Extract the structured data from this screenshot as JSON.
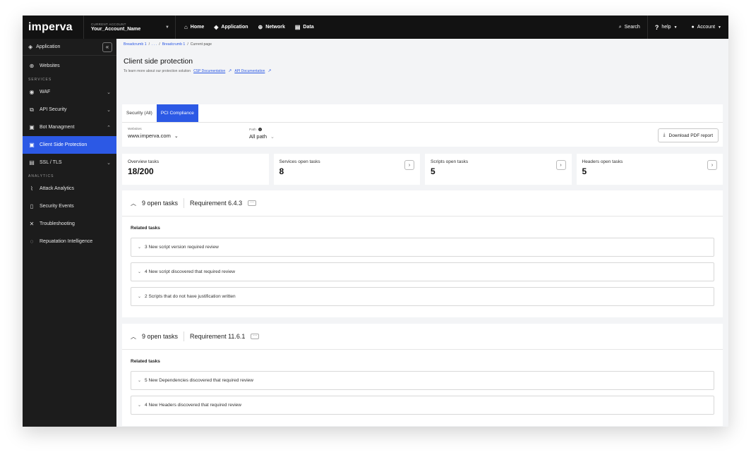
{
  "topbar": {
    "logo": "imperva",
    "account_label": "CURRENT ACCOUNT",
    "account_name": "Your_Account_Name",
    "nav": [
      {
        "label": "Home",
        "icon": "home-icon"
      },
      {
        "label": "Application",
        "icon": "application-icon"
      },
      {
        "label": "Network",
        "icon": "network-icon"
      },
      {
        "label": "Data",
        "icon": "data-icon"
      }
    ],
    "search_label": "Search",
    "help_label": "help",
    "account_menu_label": "Account"
  },
  "sidebar": {
    "header": "Application",
    "websites": "Websites",
    "services_section": "SERVICES",
    "services": [
      {
        "label": "WAF",
        "chevron": "down"
      },
      {
        "label": "API Security",
        "chevron": "down"
      },
      {
        "label": "Bot Managment",
        "chevron": "up"
      },
      {
        "label": "Client Side Protection",
        "active": true
      },
      {
        "label": "SSL / TLS",
        "chevron": "down"
      }
    ],
    "analytics_section": "ANALYTICS",
    "analytics": [
      {
        "label": "Attack Analytics"
      },
      {
        "label": "Security Events"
      },
      {
        "label": "Troubleshooting"
      },
      {
        "label": "Repuatation Intelligence"
      }
    ]
  },
  "breadcrumb": {
    "item1": "Breadcrumb 1",
    "sep1": "/",
    "ellipsis": ". . .",
    "sep2": "/",
    "item2": "Breadcrumb 1",
    "sep3": "/",
    "current": "Current page"
  },
  "page": {
    "title": "Client side protection",
    "subtitle": "To learn more about our protection solution",
    "csp_doc": "CSP Documentation",
    "api_doc": "API Documentation"
  },
  "tabs": [
    {
      "label": "Security (All)"
    },
    {
      "label": "PCI Compliance",
      "active": true
    }
  ],
  "filters": {
    "websites_label": "Websites",
    "websites_value": "www.imperva.com",
    "path_label": "Path",
    "path_value": "All path",
    "download_label": "Download PDF report"
  },
  "cards": [
    {
      "label": "Overview tasks",
      "value": "18/200"
    },
    {
      "label": "Services open tasks",
      "value": "8"
    },
    {
      "label": "Scripts open tasks",
      "value": "5"
    },
    {
      "label": "Headers open tasks",
      "value": "5"
    }
  ],
  "requirements": [
    {
      "open_tasks": "9 open tasks",
      "requirement": "Requirement 6.4.3",
      "related_label": "Related tasks",
      "tasks": [
        "3 New script version required review",
        "4 New script discovered that required review",
        "2 Scripts that do not have justification written"
      ]
    },
    {
      "open_tasks": "9 open tasks",
      "requirement": "Requirement 11.6.1",
      "related_label": "Related tasks",
      "tasks": [
        "5 New Dependencies discovered that required review",
        "4 New Headers discovered that required review"
      ]
    }
  ],
  "colors": {
    "accent": "#2c59e5",
    "topbar": "#121212",
    "sidebar": "#1c1c1c"
  }
}
